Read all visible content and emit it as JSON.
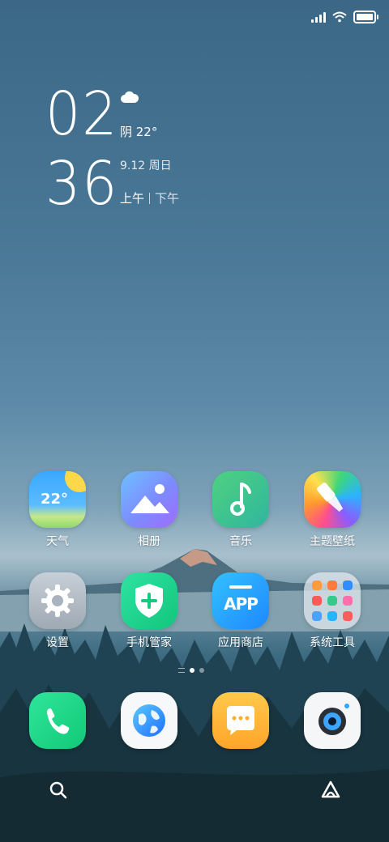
{
  "status_bar": {
    "signal": "signal-icon",
    "wifi": "wifi-icon",
    "battery": "battery-icon"
  },
  "clock": {
    "hours": "02",
    "minutes": "36",
    "weather_icon": "cloud-icon",
    "weather": "阴 22°",
    "date": "9.12 周日",
    "am": "上午",
    "pm": "下午"
  },
  "apps": [
    {
      "label": "天气",
      "icon": "weather-app-icon",
      "temp": "22°"
    },
    {
      "label": "相册",
      "icon": "gallery-app-icon"
    },
    {
      "label": "音乐",
      "icon": "music-app-icon"
    },
    {
      "label": "主题壁纸",
      "icon": "theme-app-icon"
    },
    {
      "label": "设置",
      "icon": "settings-app-icon"
    },
    {
      "label": "手机管家",
      "icon": "security-app-icon"
    },
    {
      "label": "应用商店",
      "icon": "app-store-icon",
      "badge_text": "APP"
    },
    {
      "label": "系统工具",
      "icon": "folder-icon"
    }
  ],
  "dock": [
    {
      "icon": "phone-icon"
    },
    {
      "icon": "browser-icon"
    },
    {
      "icon": "message-icon"
    },
    {
      "icon": "camera-icon"
    }
  ],
  "bottom_bar": {
    "left": "search-icon",
    "right": "assistant-icon"
  },
  "pager": {
    "pages": 2,
    "active": 1
  },
  "colors": {
    "sky_top": "#3b6886",
    "accent_green": "#12c978",
    "accent_blue": "#1e88ff"
  }
}
